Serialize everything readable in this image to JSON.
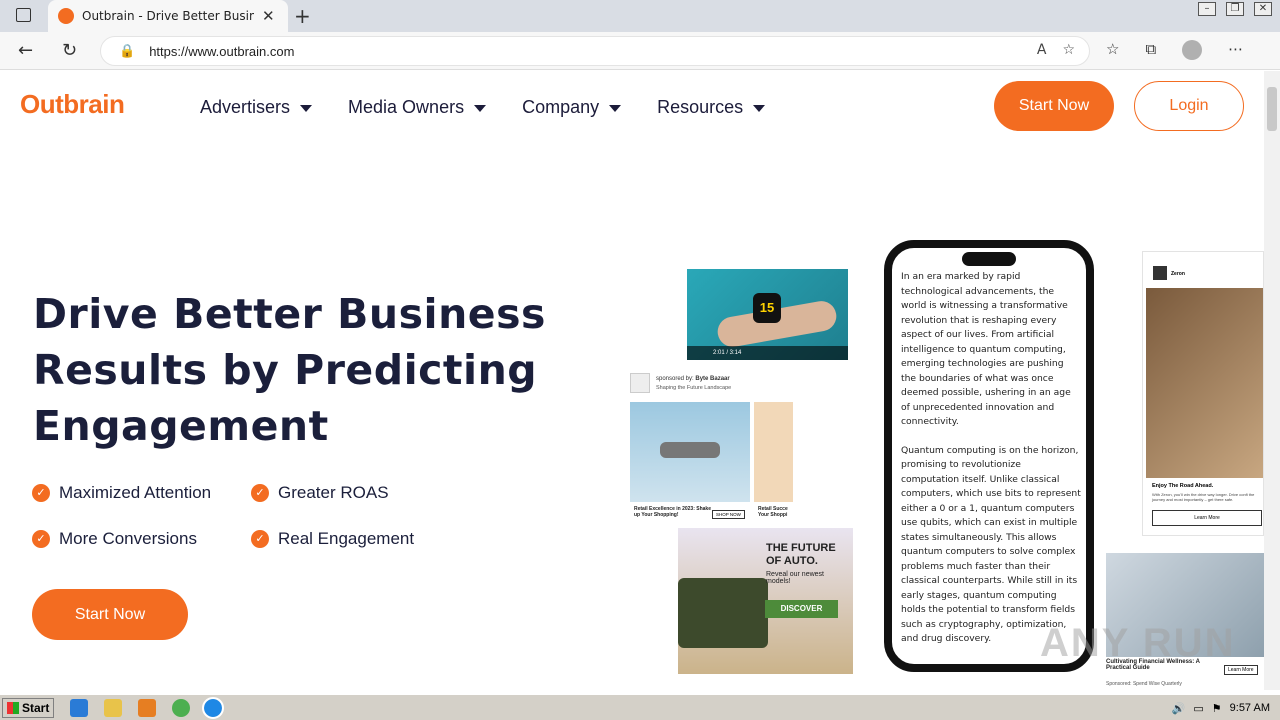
{
  "browser": {
    "tab_title": "Outbrain - Drive Better Business R",
    "url": "https://www.outbrain.com"
  },
  "nav": {
    "logo": "Outbrain",
    "menu": [
      {
        "label": "Advertisers"
      },
      {
        "label": "Media Owners"
      },
      {
        "label": "Company"
      },
      {
        "label": "Resources"
      }
    ],
    "start_label": "Start Now",
    "login_label": "Login"
  },
  "hero": {
    "headline_1": "Drive Better Business",
    "headline_2": "Results by Predicting",
    "headline_3": "Engagement",
    "features": [
      "Maximized Attention",
      "Greater ROAS",
      "More Conversions",
      "Real Engagement"
    ],
    "cta_label": "Start Now"
  },
  "cards": {
    "video_time": "2:01 / 3:14",
    "video_number": "15",
    "sponsored_by": "sponsored by:",
    "sponsor_name": "Byte Bazaar",
    "sponsor_sub": "Shaping the Future Landscape",
    "drone_caption": "Retail Excellence in 2023: Shake up Your Shopping!",
    "shop_now": "SHOP NOW",
    "retail_short": "Retail Succe Your Shoppi",
    "auto_title": "THE FUTURE OF AUTO.",
    "auto_sub": "Reveal our newest models!",
    "discover": "DISCOVER",
    "zeron": "Zeron",
    "road_title": "Enjoy The Road Ahead.",
    "road_text": "With Zeron, you'll win the drive way longer. Drive confi the journey and most importantly – get there safe.",
    "learn_more": "Learn More",
    "finance_title": "Cultivating Financial Wellness: A Practical Guide",
    "finance_sponsor": "Sponsored: Spend Wise Quarterly",
    "finance_btn": "Learn More"
  },
  "phone": {
    "para1": "In an era marked by rapid technological advancements, the world is witnessing a transformative revolution that is reshaping every aspect of our lives. From artificial intelligence to quantum computing, emerging technologies are pushing the boundaries of what was once deemed possible, ushering in an age of unprecedented innovation and connectivity.",
    "para2": "Quantum computing is on the horizon, promising to revolutionize computation itself. Unlike classical computers, which use bits to represent either a 0 or a 1, quantum computers use qubits, which can exist in multiple states simultaneously. This allows quantum computers to solve complex problems much faster than their classical counterparts. While still in its early stages, quantum computing holds the potential to transform fields such as cryptography, optimization, and drug discovery."
  },
  "taskbar": {
    "start": "Start",
    "time": "9:57 AM"
  },
  "watermark": "ANY RUN",
  "colors": {
    "brand": "#f36c21",
    "heading": "#1b1f3b"
  }
}
